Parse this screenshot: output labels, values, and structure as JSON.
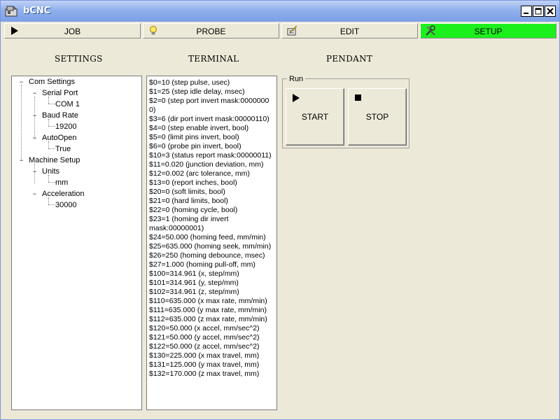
{
  "window": {
    "title": "bCNC"
  },
  "toolbar": {
    "tabs": [
      {
        "label": "JOB",
        "icon": "play-icon"
      },
      {
        "label": "PROBE",
        "icon": "lightbulb-icon"
      },
      {
        "label": "EDIT",
        "icon": "edit-icon"
      },
      {
        "label": "SETUP",
        "icon": "tools-icon",
        "active": true,
        "active_color": "#1cf01c"
      }
    ]
  },
  "sections": {
    "settings": "SETTINGS",
    "terminal": "TERMINAL",
    "pendant": "PENDANT"
  },
  "settings_tree": {
    "com_settings": "Com Settings",
    "serial_port": "Serial Port",
    "serial_port_value": "COM 1",
    "baud_rate": "Baud Rate",
    "baud_rate_value": "19200",
    "auto_open": "AutoOpen",
    "auto_open_value": "True",
    "machine_setup": "Machine Setup",
    "units": "Units",
    "units_value": "mm",
    "acceleration": "Acceleration",
    "acceleration_value": "30000"
  },
  "terminal": {
    "lines": [
      "$0=10 (step pulse, usec)",
      "$1=25 (step idle delay, msec)",
      "$2=0 (step port invert mask:00000000)",
      "$3=6 (dir port invert mask:00000110)",
      "$4=0 (step enable invert, bool)",
      "$5=0 (limit pins invert, bool)",
      "$6=0 (probe pin invert, bool)",
      "$10=3 (status report mask:00000011)",
      "$11=0.020 (junction deviation, mm)",
      "$12=0.002 (arc tolerance, mm)",
      "$13=0 (report inches, bool)",
      "$20=0 (soft limits, bool)",
      "$21=0 (hard limits, bool)",
      "$22=0 (homing cycle, bool)",
      "$23=1 (homing dir invert",
      "mask:00000001)",
      "$24=50.000 (homing feed, mm/min)",
      "$25=635.000 (homing seek, mm/min)",
      "$26=250 (homing debounce, msec)",
      "$27=1.000 (homing pull-off, mm)",
      "$100=314.961 (x, step/mm)",
      "$101=314.961 (y, step/mm)",
      "$102=314.961 (z, step/mm)",
      "$110=635.000 (x max rate, mm/min)",
      "$111=635.000 (y max rate, mm/min)",
      "$112=635.000 (z max rate, mm/min)",
      "$120=50.000 (x accel, mm/sec^2)",
      "$121=50.000 (y accel, mm/sec^2)",
      "$122=50.000 (z accel, mm/sec^2)",
      "$130=225.000 (x max travel, mm)",
      "$131=125.000 (y max travel, mm)",
      "$132=170.000 (z max travel, mm)"
    ]
  },
  "pendant": {
    "group_label": "Run",
    "start_label": "START",
    "stop_label": "STOP"
  }
}
